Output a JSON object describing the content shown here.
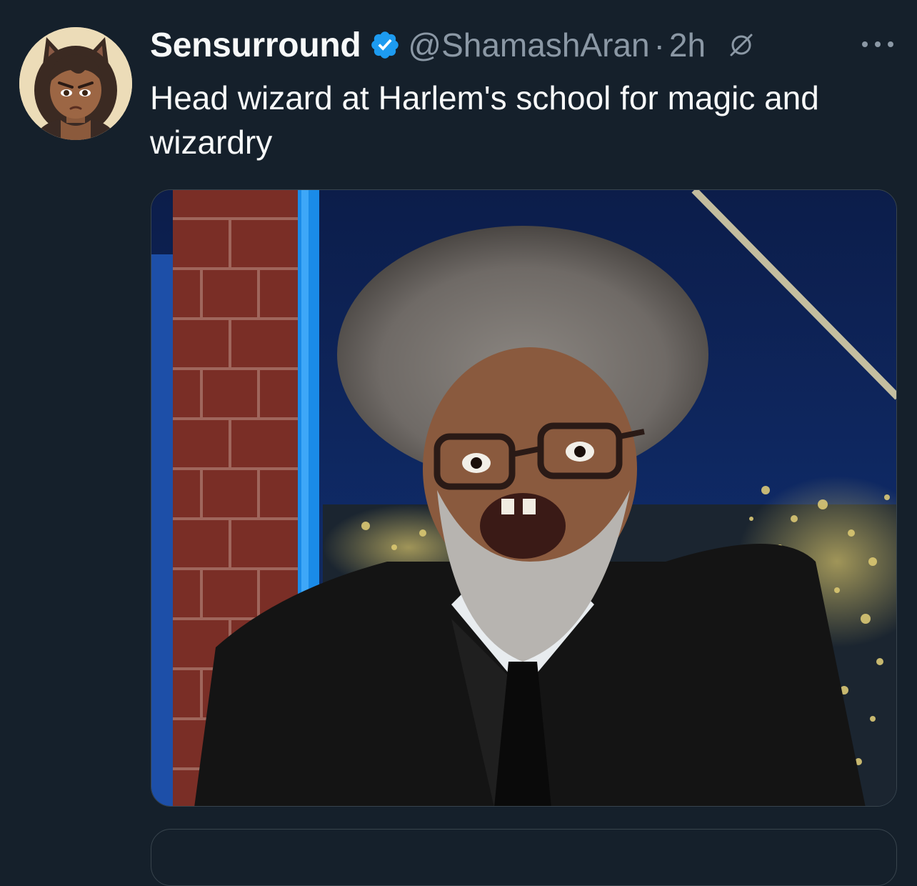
{
  "tweet": {
    "author": {
      "display_name": "Sensurround",
      "handle": "@ShamashAran",
      "verified": true,
      "avatar_icon": "cat-girl-avatar-illustration"
    },
    "separator": "·",
    "time": "2h",
    "text": "Head wizard at Harlem's school for magic and wizardry",
    "media": {
      "type": "photo",
      "content": "man-with-grey-afro-and-glasses-photo"
    }
  },
  "colors": {
    "background": "#15202b",
    "text_primary": "#f7f9f9",
    "text_secondary": "#8b98a5",
    "verified_blue": "#1d9bf0",
    "border": "#38444d"
  }
}
